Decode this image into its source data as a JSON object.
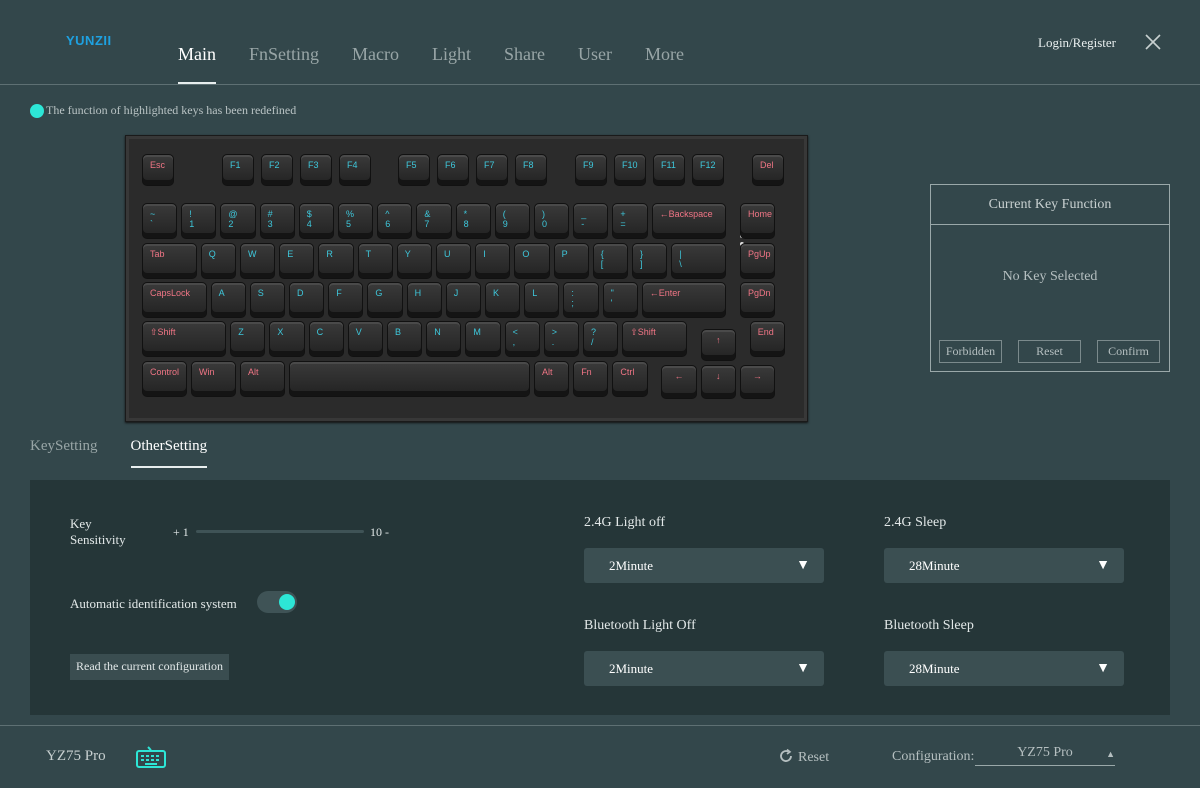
{
  "app": {
    "logo": "YUNZII",
    "login": "Login/Register"
  },
  "nav": {
    "tabs": [
      "Main",
      "FnSetting",
      "Macro",
      "Light",
      "Share",
      "User",
      "More"
    ],
    "active": "Main"
  },
  "notice": "The function of highlighted keys has been redefined",
  "keyboard": {
    "keys": [
      {
        "row": 0,
        "l": "Esc",
        "r": true
      },
      {
        "row": 0,
        "l": "F1"
      },
      {
        "row": 0,
        "l": "F2"
      },
      {
        "row": 0,
        "l": "F3"
      },
      {
        "row": 0,
        "l": "F4"
      },
      {
        "row": 0,
        "l": "F5"
      },
      {
        "row": 0,
        "l": "F6"
      },
      {
        "row": 0,
        "l": "F7"
      },
      {
        "row": 0,
        "l": "F8"
      },
      {
        "row": 0,
        "l": "F9"
      },
      {
        "row": 0,
        "l": "F10"
      },
      {
        "row": 0,
        "l": "F11"
      },
      {
        "row": 0,
        "l": "F12"
      },
      {
        "row": 0,
        "l": "Del",
        "r": true
      },
      {
        "row": 1,
        "l": "~\n`"
      },
      {
        "row": 1,
        "l": "!\n1"
      },
      {
        "row": 1,
        "l": "@\n2"
      },
      {
        "row": 1,
        "l": "#\n3"
      },
      {
        "row": 1,
        "l": "$\n4"
      },
      {
        "row": 1,
        "l": "%\n5"
      },
      {
        "row": 1,
        "l": "^\n6"
      },
      {
        "row": 1,
        "l": "&\n7"
      },
      {
        "row": 1,
        "l": "*\n8"
      },
      {
        "row": 1,
        "l": "(\n9"
      },
      {
        "row": 1,
        "l": ")\n0"
      },
      {
        "row": 1,
        "l": "_\n-"
      },
      {
        "row": 1,
        "l": "+\n="
      },
      {
        "row": 1,
        "l": "←Backspace",
        "r": true
      },
      {
        "row": 1,
        "l": "Home",
        "r": true
      },
      {
        "row": 2,
        "l": "Tab",
        "r": true
      },
      {
        "row": 2,
        "l": "Q"
      },
      {
        "row": 2,
        "l": "W"
      },
      {
        "row": 2,
        "l": "E"
      },
      {
        "row": 2,
        "l": "R"
      },
      {
        "row": 2,
        "l": "T"
      },
      {
        "row": 2,
        "l": "Y"
      },
      {
        "row": 2,
        "l": "U"
      },
      {
        "row": 2,
        "l": "I"
      },
      {
        "row": 2,
        "l": "O"
      },
      {
        "row": 2,
        "l": "P"
      },
      {
        "row": 2,
        "l": "{\n["
      },
      {
        "row": 2,
        "l": "}\n]"
      },
      {
        "row": 2,
        "l": "|\n\\"
      },
      {
        "row": 2,
        "l": "PgUp",
        "r": true
      },
      {
        "row": 3,
        "l": "CapsLock",
        "r": true
      },
      {
        "row": 3,
        "l": "A"
      },
      {
        "row": 3,
        "l": "S"
      },
      {
        "row": 3,
        "l": "D"
      },
      {
        "row": 3,
        "l": "F"
      },
      {
        "row": 3,
        "l": "G"
      },
      {
        "row": 3,
        "l": "H"
      },
      {
        "row": 3,
        "l": "J"
      },
      {
        "row": 3,
        "l": "K"
      },
      {
        "row": 3,
        "l": "L"
      },
      {
        "row": 3,
        "l": ":\n;"
      },
      {
        "row": 3,
        "l": "\"\n'"
      },
      {
        "row": 3,
        "l": "←Enter",
        "r": true
      },
      {
        "row": 3,
        "l": "PgDn",
        "r": true
      },
      {
        "row": 4,
        "l": "⇧Shift",
        "r": true
      },
      {
        "row": 4,
        "l": "Z"
      },
      {
        "row": 4,
        "l": "X"
      },
      {
        "row": 4,
        "l": "C"
      },
      {
        "row": 4,
        "l": "V"
      },
      {
        "row": 4,
        "l": "B"
      },
      {
        "row": 4,
        "l": "N"
      },
      {
        "row": 4,
        "l": "M"
      },
      {
        "row": 4,
        "l": "<\n,"
      },
      {
        "row": 4,
        "l": ">\n."
      },
      {
        "row": 4,
        "l": "?\n/"
      },
      {
        "row": 4,
        "l": "⇧Shift",
        "r": true
      },
      {
        "row": 4,
        "l": "↑",
        "r": true
      },
      {
        "row": 4,
        "l": "End",
        "r": true
      },
      {
        "row": 5,
        "l": "Control",
        "r": true
      },
      {
        "row": 5,
        "l": "Win",
        "r": true
      },
      {
        "row": 5,
        "l": "Alt",
        "r": true
      },
      {
        "row": 5,
        "l": ""
      },
      {
        "row": 5,
        "l": "Alt",
        "r": true
      },
      {
        "row": 5,
        "l": "Fn",
        "r": true
      },
      {
        "row": 5,
        "l": "Ctrl",
        "r": true
      },
      {
        "row": 5,
        "l": "←",
        "r": true
      },
      {
        "row": 5,
        "l": "↓",
        "r": true
      },
      {
        "row": 5,
        "l": "→",
        "r": true
      }
    ]
  },
  "current_key": {
    "title": "Current Key Function",
    "message": "No Key Selected",
    "buttons": [
      "Forbidden",
      "Reset",
      "Confirm"
    ]
  },
  "subtabs": {
    "items": [
      "KeySetting",
      "OtherSetting"
    ],
    "active": "OtherSetting"
  },
  "settings": {
    "sensitivity_label": "Key\nSensitivity",
    "slider_min": "+ 1",
    "slider_max": "10 -",
    "auto_id_label": "Automatic identification system",
    "auto_id_on": true,
    "read_config": "Read the current configuration",
    "light_off_24g_label": "2.4G Light off",
    "light_off_24g_value": "2Minute",
    "sleep_24g_label": "2.4G Sleep",
    "sleep_24g_value": "28Minute",
    "bt_light_off_label": "Bluetooth Light Off",
    "bt_light_off_value": "2Minute",
    "bt_sleep_label": "Bluetooth Sleep",
    "bt_sleep_value": "28Minute",
    "arrow": "▼"
  },
  "footer": {
    "device": "YZ75 Pro",
    "reset": "Reset",
    "config_label": "Configuration:",
    "config_value": "YZ75 Pro",
    "config_arrow": "▲"
  },
  "colors": {
    "accent": "#2de6d6",
    "bg": "#33474b",
    "panel": "#253638",
    "key_blue": "#3ec8dc",
    "key_red": "#f07585"
  }
}
